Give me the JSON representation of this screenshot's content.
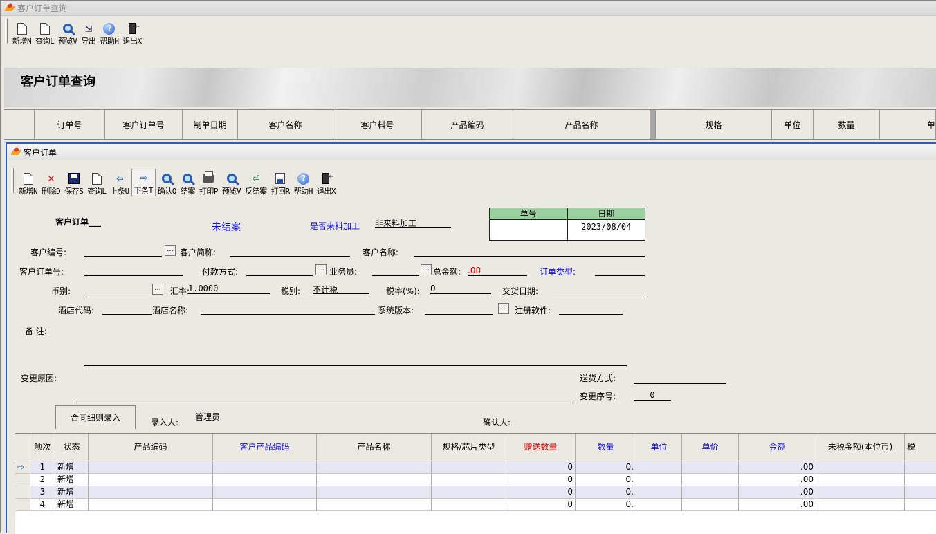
{
  "outer": {
    "title": "客户订单查询",
    "toolbar": [
      "新增N",
      "查询L",
      "预览V",
      "导出",
      "帮助H",
      "退出X"
    ],
    "banner_title": "客户订单查询",
    "columns": [
      "订单号",
      "客户订单号",
      "制单日期",
      "客户名称",
      "客户料号",
      "产品编码",
      "产品名称",
      "规格",
      "单位",
      "数量",
      "单"
    ]
  },
  "inner": {
    "title": "客户订单",
    "toolbar": [
      "新增N",
      "删除D",
      "保存S",
      "查询L",
      "上条U",
      "下条T",
      "确认Q",
      "结案",
      "打印P",
      "预览V",
      "反结案",
      "打回R",
      "帮助H",
      "退出X"
    ]
  },
  "form": {
    "heading": "客户订单___",
    "status": "未结案",
    "incoming_label": "是否来料加工",
    "incoming_value": "非来料加工",
    "no_label": "单号",
    "date_label": "日期",
    "no_value": "",
    "date_value": "2023/08/04",
    "customer_no_label": "客户编号:",
    "customer_short_label": "客户简称:",
    "customer_name_label": "客户名称:",
    "customer_order_label": "客户订单号:",
    "payment_label": "付款方式:",
    "salesman_label": "业务员:",
    "total_label": "总金额:",
    "total_value": ".00",
    "order_type_label": "订单类型:",
    "currency_label": "币别:",
    "rate_label": "汇率:",
    "rate_value": "1.0000",
    "tax_type_label": "税别:",
    "tax_type_value": "不计税",
    "tax_rate_label": "税率(%):",
    "tax_rate_value": "0",
    "delivery_date_label": "交货日期:",
    "hotel_code_label": "酒店代码:",
    "hotel_name_label": "酒店名称:",
    "sys_version_label": "系统版本:",
    "reg_software_label": "注册软件:",
    "remark_label": "备    注:",
    "change_reason_label": "变更原因:",
    "ship_method_label": "送货方式:",
    "change_seq_label": "变更序号:",
    "change_seq_value": "0",
    "tab_label": "合同细则录入",
    "entry_person_label": "录入人:",
    "entry_person_value": "管理员",
    "confirm_person_label": "确认人:"
  },
  "detail": {
    "headers": [
      "项次",
      "状态",
      "产品编码",
      "客户产品编码",
      "产品名称",
      "规格/芯片类型",
      "赠送数量",
      "数量",
      "单位",
      "单价",
      "金额",
      "未税金额(本位币)",
      "税"
    ],
    "rows": [
      {
        "no": "1",
        "status": "新增",
        "gift": "0",
        "qty": "0.",
        "amount": ".00"
      },
      {
        "no": "2",
        "status": "新增",
        "gift": "0",
        "qty": "0.",
        "amount": ".00"
      },
      {
        "no": "3",
        "status": "新增",
        "gift": "0",
        "qty": "0.",
        "amount": ".00"
      },
      {
        "no": "4",
        "status": "新增",
        "gift": "0",
        "qty": "0.",
        "amount": ".00"
      }
    ]
  },
  "colors": {
    "blue": "#1010ff",
    "red": "#e00000",
    "accent": "#2b5fd4"
  }
}
